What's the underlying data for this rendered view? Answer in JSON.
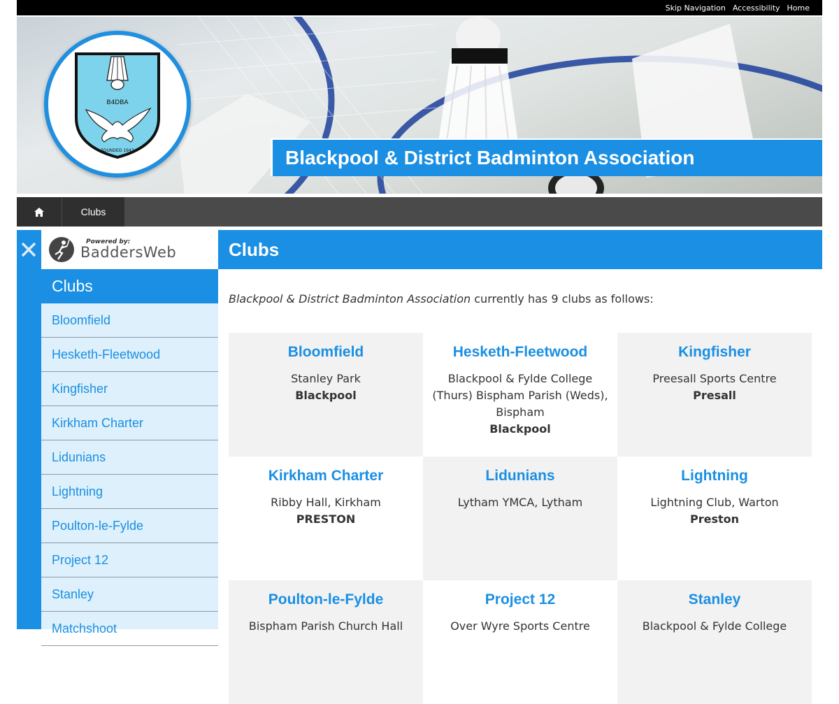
{
  "topbar": {
    "links": [
      "Skip Navigation",
      "Accessibility",
      "Home"
    ]
  },
  "banner": {
    "title": "Blackpool & District Badminton Association",
    "logo": {
      "abbr": "B4DBA",
      "founded": "FOUNDED 1947"
    }
  },
  "nav": {
    "home_icon": "home-icon",
    "items": [
      "Clubs"
    ]
  },
  "sidebar": {
    "powered_by": "Powered by:",
    "brand": "BaddersWeb",
    "heading": "Clubs",
    "items": [
      "Bloomfield",
      "Hesketh-Fleetwood",
      "Kingfisher",
      "Kirkham Charter",
      "Lidunians",
      "Lightning",
      "Poulton-le-Fylde",
      "Project 12",
      "Stanley",
      "Matchshoot"
    ]
  },
  "main": {
    "heading": "Clubs",
    "intro_assoc": "Blackpool & District Badminton Association",
    "intro_rest": " currently has 9 clubs as follows:",
    "clubs": [
      {
        "name": "Bloomfield",
        "venue": "Stanley Park",
        "town": "Blackpool"
      },
      {
        "name": "Hesketh-Fleetwood",
        "venue": "Blackpool & Fylde College (Thurs) Bispham Parish (Weds), Bispham",
        "town": "Blackpool"
      },
      {
        "name": "Kingfisher",
        "venue": "Preesall Sports Centre",
        "town": "Presall"
      },
      {
        "name": "Kirkham Charter",
        "venue": "Ribby Hall, Kirkham",
        "town": "PRESTON"
      },
      {
        "name": "Lidunians",
        "venue": "Lytham YMCA, Lytham",
        "town": ""
      },
      {
        "name": "Lightning",
        "venue": "Lightning Club, Warton",
        "town": "Preston"
      },
      {
        "name": "Poulton-le-Fylde",
        "venue": "Bispham Parish Church Hall",
        "town": ""
      },
      {
        "name": "Project 12",
        "venue": "Over Wyre Sports Centre",
        "town": ""
      },
      {
        "name": "Stanley",
        "venue": "Blackpool & Fylde College",
        "town": ""
      }
    ]
  },
  "colors": {
    "accent": "#1a8fe3",
    "nav_bg": "#4a4a4a",
    "sidebar_bg": "#ddf0fb"
  }
}
